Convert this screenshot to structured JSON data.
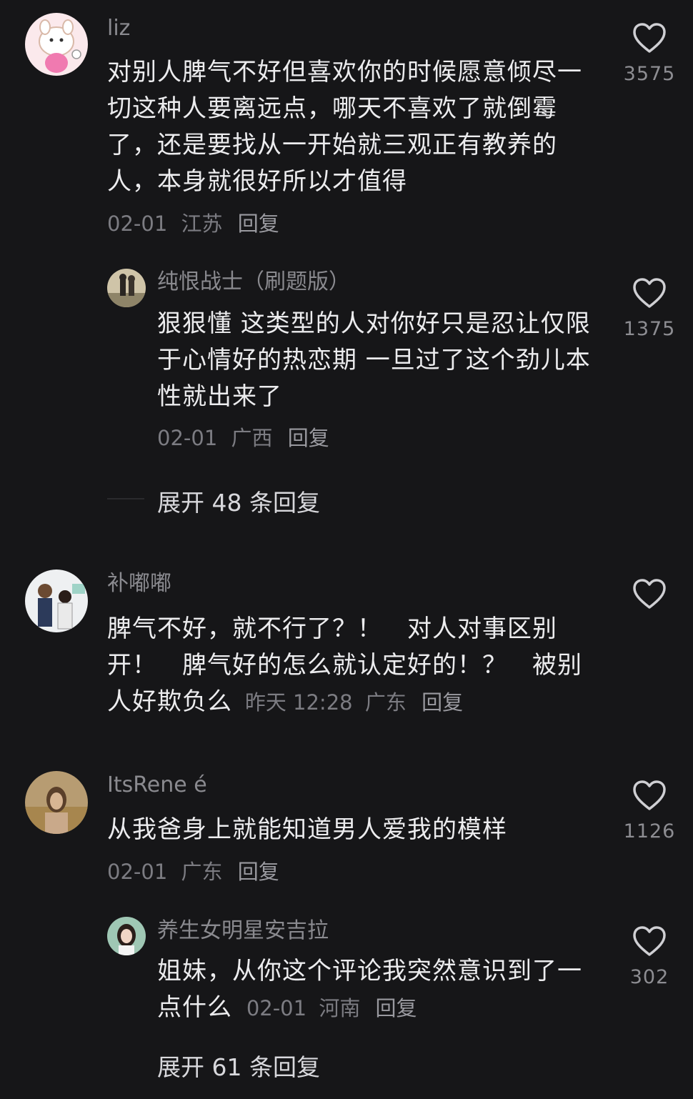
{
  "comments": [
    {
      "name": "liz",
      "text": "对别人脾气不好但喜欢你的时候愿意倾尽一切这种人要离远点，哪天不喜欢了就倒霉了，还是要找从一开始就三观正有教养的人，本身就很好所以才值得",
      "date": "02-01",
      "location": "江苏",
      "reply_label": "回复",
      "likes": "3575",
      "avatar": "cartoon-bunny-avatar",
      "replies": [
        {
          "name": "纯恨战士（刷题版）",
          "text": "狠狠懂 这类型的人对你好只是忍让仅限于心情好的热恋期 一旦过了这个劲儿本性就出来了",
          "date": "02-01",
          "location": "广西",
          "reply_label": "回复",
          "likes": "1375"
        }
      ],
      "expand_label": "展开 48 条回复"
    },
    {
      "name": "补嘟嘟",
      "text": "脾气不好，就不行了？！　对人对事区别开！　脾气好的怎么就认定好的！？　被别人好欺负么",
      "date": "昨天 12:28",
      "location": "广东",
      "reply_label": "回复",
      "likes": ""
    },
    {
      "name": "ItsRene é",
      "text": "从我爸身上就能知道男人爱我的模样",
      "date": "02-01",
      "location": "广东",
      "reply_label": "回复",
      "likes": "1126",
      "replies": [
        {
          "name": "养生女明星安吉拉",
          "text": "姐妹，从你这个评论我突然意识到了一点什么",
          "date": "02-01",
          "location": "河南",
          "reply_label": "回复",
          "likes": "302"
        }
      ],
      "expand_label": "展开 61 条回复"
    }
  ],
  "colors": {
    "background": "#161618",
    "text": "#ececee",
    "muted": "#7c7c82"
  },
  "icons": {
    "like": "heart-outline-icon"
  }
}
